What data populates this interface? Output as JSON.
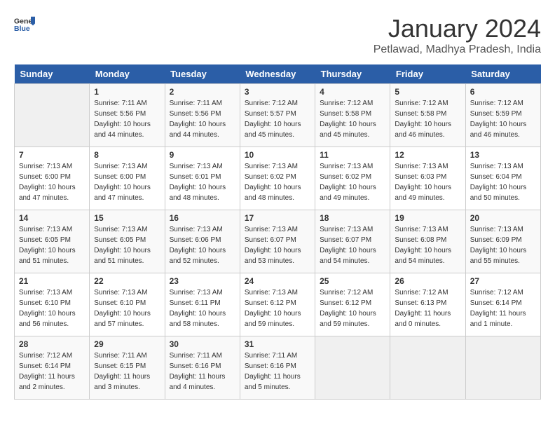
{
  "header": {
    "logo_general": "General",
    "logo_blue": "Blue",
    "title": "January 2024",
    "subtitle": "Petlawad, Madhya Pradesh, India"
  },
  "weekdays": [
    "Sunday",
    "Monday",
    "Tuesday",
    "Wednesday",
    "Thursday",
    "Friday",
    "Saturday"
  ],
  "weeks": [
    [
      {
        "day": "",
        "empty": true
      },
      {
        "day": "1",
        "sunrise": "Sunrise: 7:11 AM",
        "sunset": "Sunset: 5:56 PM",
        "daylight": "Daylight: 10 hours and 44 minutes."
      },
      {
        "day": "2",
        "sunrise": "Sunrise: 7:11 AM",
        "sunset": "Sunset: 5:56 PM",
        "daylight": "Daylight: 10 hours and 44 minutes."
      },
      {
        "day": "3",
        "sunrise": "Sunrise: 7:12 AM",
        "sunset": "Sunset: 5:57 PM",
        "daylight": "Daylight: 10 hours and 45 minutes."
      },
      {
        "day": "4",
        "sunrise": "Sunrise: 7:12 AM",
        "sunset": "Sunset: 5:58 PM",
        "daylight": "Daylight: 10 hours and 45 minutes."
      },
      {
        "day": "5",
        "sunrise": "Sunrise: 7:12 AM",
        "sunset": "Sunset: 5:58 PM",
        "daylight": "Daylight: 10 hours and 46 minutes."
      },
      {
        "day": "6",
        "sunrise": "Sunrise: 7:12 AM",
        "sunset": "Sunset: 5:59 PM",
        "daylight": "Daylight: 10 hours and 46 minutes."
      }
    ],
    [
      {
        "day": "7",
        "sunrise": "Sunrise: 7:13 AM",
        "sunset": "Sunset: 6:00 PM",
        "daylight": "Daylight: 10 hours and 47 minutes."
      },
      {
        "day": "8",
        "sunrise": "Sunrise: 7:13 AM",
        "sunset": "Sunset: 6:00 PM",
        "daylight": "Daylight: 10 hours and 47 minutes."
      },
      {
        "day": "9",
        "sunrise": "Sunrise: 7:13 AM",
        "sunset": "Sunset: 6:01 PM",
        "daylight": "Daylight: 10 hours and 48 minutes."
      },
      {
        "day": "10",
        "sunrise": "Sunrise: 7:13 AM",
        "sunset": "Sunset: 6:02 PM",
        "daylight": "Daylight: 10 hours and 48 minutes."
      },
      {
        "day": "11",
        "sunrise": "Sunrise: 7:13 AM",
        "sunset": "Sunset: 6:02 PM",
        "daylight": "Daylight: 10 hours and 49 minutes."
      },
      {
        "day": "12",
        "sunrise": "Sunrise: 7:13 AM",
        "sunset": "Sunset: 6:03 PM",
        "daylight": "Daylight: 10 hours and 49 minutes."
      },
      {
        "day": "13",
        "sunrise": "Sunrise: 7:13 AM",
        "sunset": "Sunset: 6:04 PM",
        "daylight": "Daylight: 10 hours and 50 minutes."
      }
    ],
    [
      {
        "day": "14",
        "sunrise": "Sunrise: 7:13 AM",
        "sunset": "Sunset: 6:05 PM",
        "daylight": "Daylight: 10 hours and 51 minutes."
      },
      {
        "day": "15",
        "sunrise": "Sunrise: 7:13 AM",
        "sunset": "Sunset: 6:05 PM",
        "daylight": "Daylight: 10 hours and 51 minutes."
      },
      {
        "day": "16",
        "sunrise": "Sunrise: 7:13 AM",
        "sunset": "Sunset: 6:06 PM",
        "daylight": "Daylight: 10 hours and 52 minutes."
      },
      {
        "day": "17",
        "sunrise": "Sunrise: 7:13 AM",
        "sunset": "Sunset: 6:07 PM",
        "daylight": "Daylight: 10 hours and 53 minutes."
      },
      {
        "day": "18",
        "sunrise": "Sunrise: 7:13 AM",
        "sunset": "Sunset: 6:07 PM",
        "daylight": "Daylight: 10 hours and 54 minutes."
      },
      {
        "day": "19",
        "sunrise": "Sunrise: 7:13 AM",
        "sunset": "Sunset: 6:08 PM",
        "daylight": "Daylight: 10 hours and 54 minutes."
      },
      {
        "day": "20",
        "sunrise": "Sunrise: 7:13 AM",
        "sunset": "Sunset: 6:09 PM",
        "daylight": "Daylight: 10 hours and 55 minutes."
      }
    ],
    [
      {
        "day": "21",
        "sunrise": "Sunrise: 7:13 AM",
        "sunset": "Sunset: 6:10 PM",
        "daylight": "Daylight: 10 hours and 56 minutes."
      },
      {
        "day": "22",
        "sunrise": "Sunrise: 7:13 AM",
        "sunset": "Sunset: 6:10 PM",
        "daylight": "Daylight: 10 hours and 57 minutes."
      },
      {
        "day": "23",
        "sunrise": "Sunrise: 7:13 AM",
        "sunset": "Sunset: 6:11 PM",
        "daylight": "Daylight: 10 hours and 58 minutes."
      },
      {
        "day": "24",
        "sunrise": "Sunrise: 7:13 AM",
        "sunset": "Sunset: 6:12 PM",
        "daylight": "Daylight: 10 hours and 59 minutes."
      },
      {
        "day": "25",
        "sunrise": "Sunrise: 7:12 AM",
        "sunset": "Sunset: 6:12 PM",
        "daylight": "Daylight: 10 hours and 59 minutes."
      },
      {
        "day": "26",
        "sunrise": "Sunrise: 7:12 AM",
        "sunset": "Sunset: 6:13 PM",
        "daylight": "Daylight: 11 hours and 0 minutes."
      },
      {
        "day": "27",
        "sunrise": "Sunrise: 7:12 AM",
        "sunset": "Sunset: 6:14 PM",
        "daylight": "Daylight: 11 hours and 1 minute."
      }
    ],
    [
      {
        "day": "28",
        "sunrise": "Sunrise: 7:12 AM",
        "sunset": "Sunset: 6:14 PM",
        "daylight": "Daylight: 11 hours and 2 minutes."
      },
      {
        "day": "29",
        "sunrise": "Sunrise: 7:11 AM",
        "sunset": "Sunset: 6:15 PM",
        "daylight": "Daylight: 11 hours and 3 minutes."
      },
      {
        "day": "30",
        "sunrise": "Sunrise: 7:11 AM",
        "sunset": "Sunset: 6:16 PM",
        "daylight": "Daylight: 11 hours and 4 minutes."
      },
      {
        "day": "31",
        "sunrise": "Sunrise: 7:11 AM",
        "sunset": "Sunset: 6:16 PM",
        "daylight": "Daylight: 11 hours and 5 minutes."
      },
      {
        "day": "",
        "empty": true
      },
      {
        "day": "",
        "empty": true
      },
      {
        "day": "",
        "empty": true
      }
    ]
  ]
}
